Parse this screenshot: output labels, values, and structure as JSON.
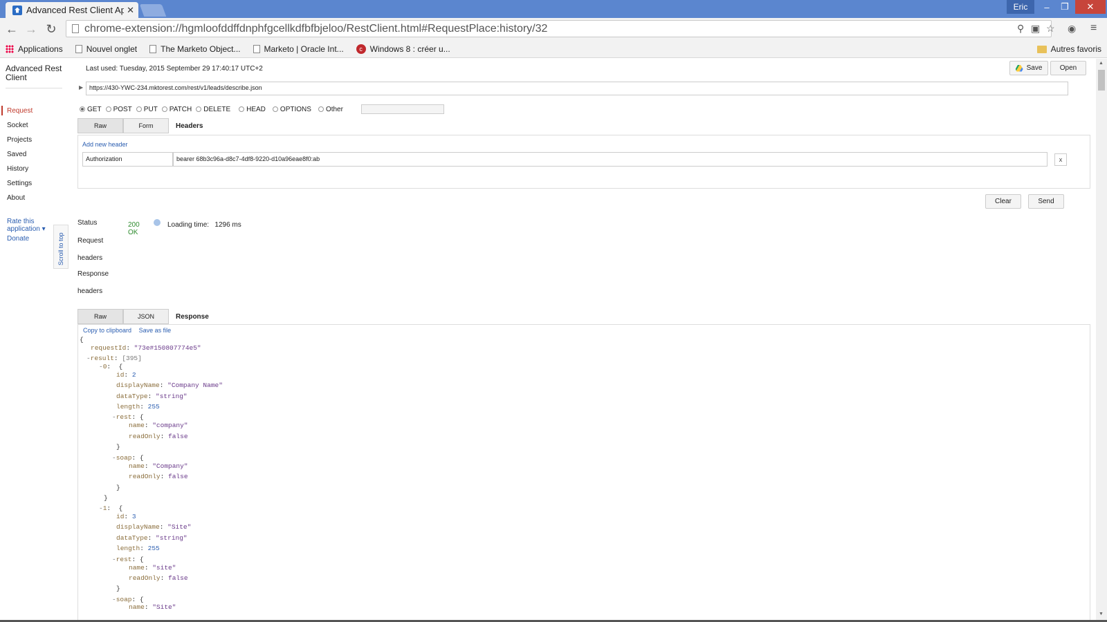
{
  "browser": {
    "tab_title": "Advanced Rest Client App",
    "tab_close": "✕",
    "user": "Eric",
    "url": "chrome-extension://hgmloofddffdnphfgcellkdfbfbjeloo/RestClient.html#RequestPlace:history/32",
    "bookmarks": [
      "Applications",
      "Nouvel onglet",
      "The Marketo Object...",
      "Marketo | Oracle Int...",
      "Windows 8 : créer u..."
    ],
    "other_bookmarks": "Autres favoris"
  },
  "sidebar": {
    "app_title": "Advanced Rest Client",
    "items": [
      "Request",
      "Socket",
      "Projects",
      "Saved",
      "History",
      "Settings",
      "About"
    ],
    "rate": "Rate this application ▾",
    "donate": "Donate",
    "scroll_to_top": "Scroll to top"
  },
  "request": {
    "last_used": "Last used: Tuesday, 2015 September 29 17:40:17 UTC+2",
    "save_label": "Save",
    "open_label": "Open",
    "url": "https://430-YWC-234.mktorest.com/rest/v1/leads/describe.json",
    "methods": [
      "GET",
      "POST",
      "PUT",
      "PATCH",
      "DELETE",
      "HEAD",
      "OPTIONS",
      "Other"
    ],
    "selected_method": "GET",
    "tabs": [
      "Raw",
      "Form"
    ],
    "tabs_label": "Headers",
    "add_header": "Add new header",
    "header_name": "Authorization",
    "header_value": "bearer 68b3c96a-d8c7-4df8-9220-d10a96eae8f0:ab",
    "remove": "x",
    "clear_label": "Clear",
    "send_label": "Send"
  },
  "response": {
    "status_label": "Status",
    "status_value": "200 OK",
    "loading_label": "Loading time:",
    "loading_value": "1296 ms",
    "request_label": "Request",
    "headers_label": "headers",
    "response_label": "Response",
    "tabs": [
      "Raw",
      "JSON"
    ],
    "tabs_label": "Response",
    "copy": "Copy to clipboard",
    "save_file": "Save as file",
    "json": {
      "requestId": "\"73e#150807774e5\"",
      "result_count": "[395]",
      "items": [
        {
          "idx": "0",
          "id": "2",
          "displayName": "\"Company Name\"",
          "dataType": "\"string\"",
          "length": "255",
          "rest_name": "\"company\"",
          "rest_readOnly": "false",
          "soap_name": "\"Company\"",
          "soap_readOnly": "false"
        },
        {
          "idx": "1",
          "id": "3",
          "displayName": "\"Site\"",
          "dataType": "\"string\"",
          "length": "255",
          "rest_name": "\"site\"",
          "rest_readOnly": "false",
          "soap_name": "\"Site\""
        }
      ]
    }
  }
}
